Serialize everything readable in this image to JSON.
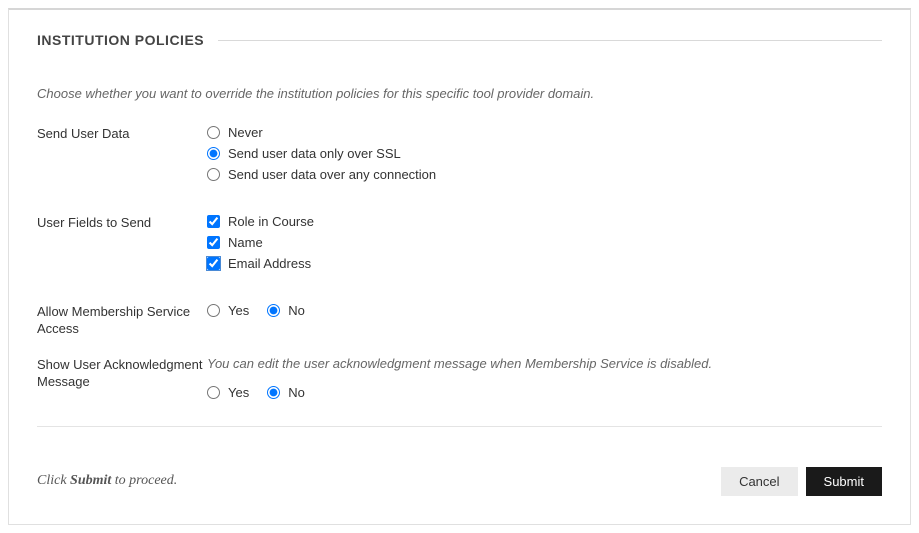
{
  "section": {
    "title": "INSTITUTION POLICIES",
    "intro": "Choose whether you want to override the institution policies for this specific tool provider domain."
  },
  "sendUserData": {
    "label": "Send User Data",
    "options": {
      "never": "Never",
      "ssl": "Send user data only over SSL",
      "any": "Send user data over any connection"
    },
    "selected": "ssl"
  },
  "userFields": {
    "label": "User Fields to Send",
    "options": {
      "role": "Role in Course",
      "name": "Name",
      "email": "Email Address"
    }
  },
  "membership": {
    "label": "Allow Membership Service Access",
    "yes": "Yes",
    "no": "No"
  },
  "ack": {
    "label": "Show User Acknowledgment Message",
    "helper": "You can edit the user acknowledgment message when Membership Service is disabled.",
    "yes": "Yes",
    "no": "No"
  },
  "footer": {
    "hintPrefix": "Click ",
    "hintBold": "Submit",
    "hintSuffix": " to proceed.",
    "cancel": "Cancel",
    "submit": "Submit"
  }
}
